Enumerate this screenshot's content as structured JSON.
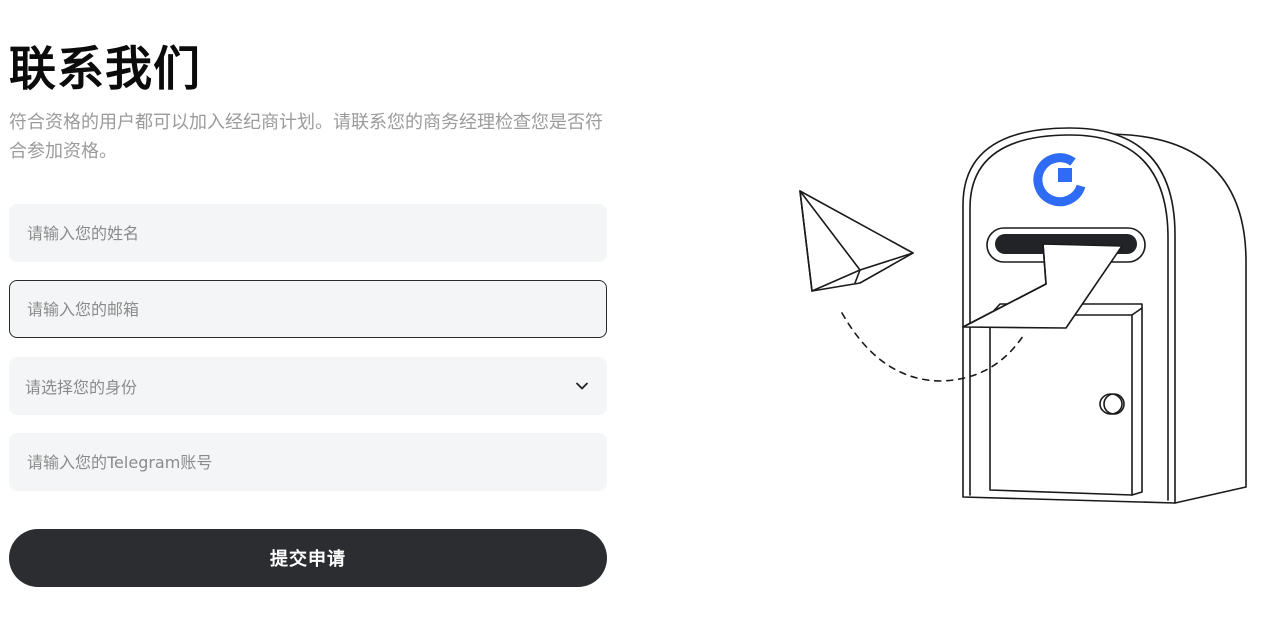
{
  "header": {
    "title": "联系我们",
    "subtitle": "符合资格的用户都可以加入经纪商计划。请联系您的商务经理检查您是否符合参加资格。"
  },
  "form": {
    "name_placeholder": "请输入您的姓名",
    "email_placeholder": "请输入您的邮箱",
    "identity_placeholder": "请选择您的身份",
    "telegram_placeholder": "请输入您的Telegram账号",
    "submit_label": "提交申请"
  },
  "colors": {
    "accent": "#2f6cf5",
    "button": "#2c2d31",
    "field_bg": "#f4f5f6"
  },
  "icons": {
    "select": "chevron-down-icon",
    "illustration": "mailbox-paper-plane-illustration",
    "logo": "brand-logo-icon"
  }
}
